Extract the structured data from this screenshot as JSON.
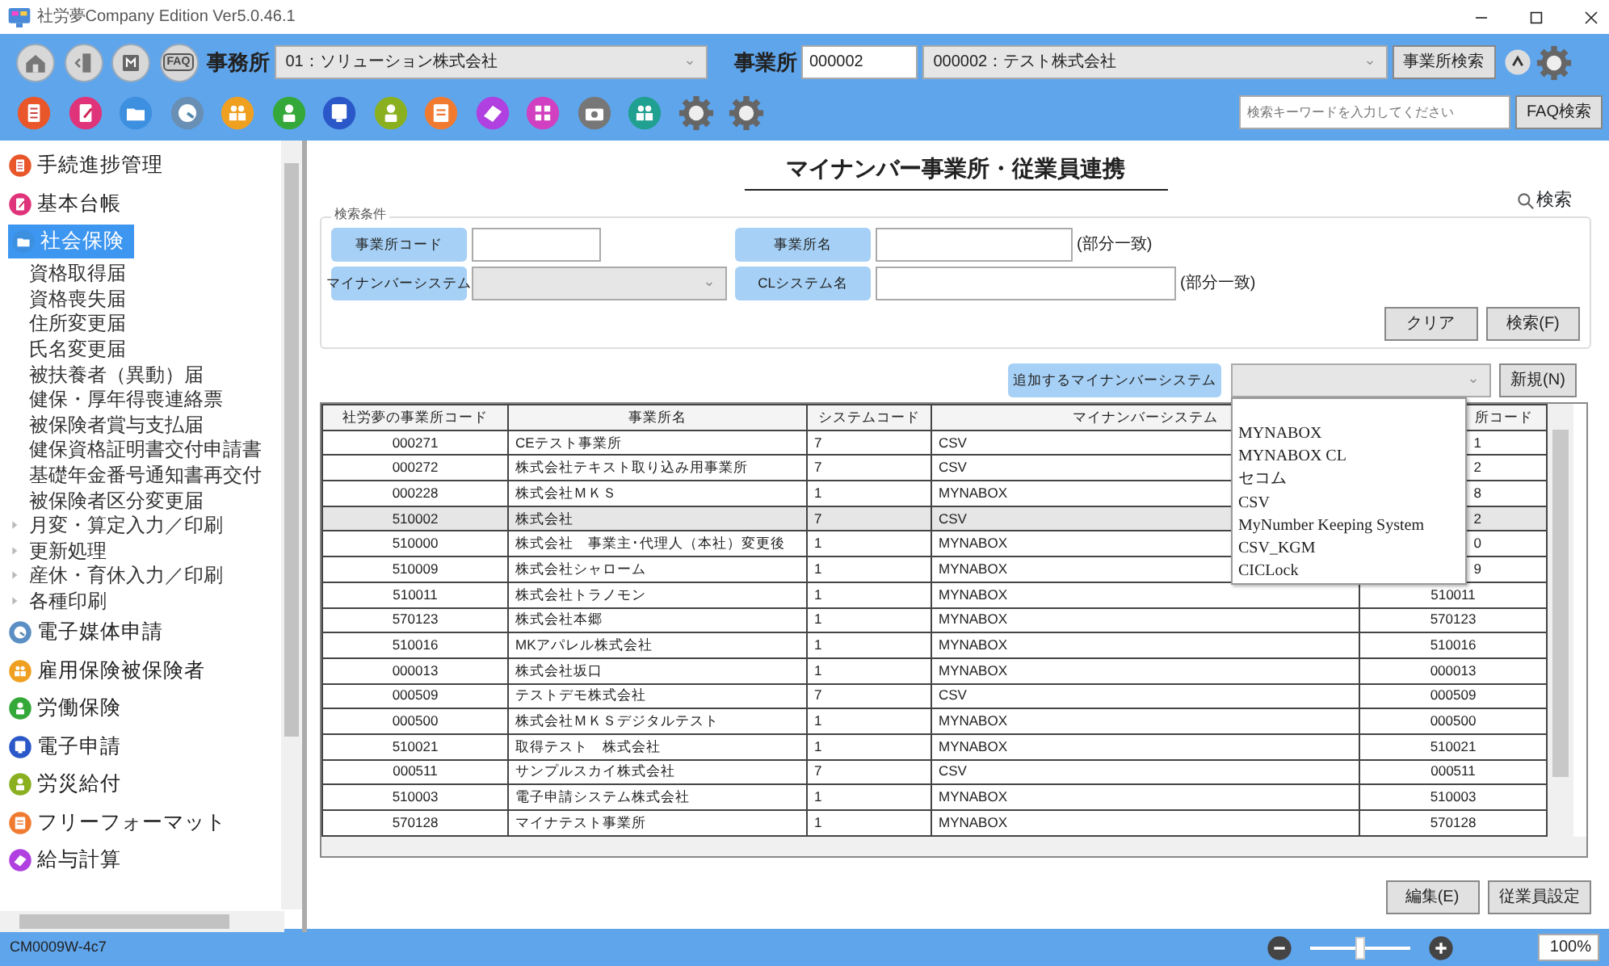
{
  "window": {
    "title": "社労夢Company Edition Ver5.0.46.1"
  },
  "toolbar": {
    "faq_button": "FAQ",
    "office_label": "事務所",
    "office_select": "01：ソリューション株式会社",
    "site_label": "事業所",
    "site_code": "000002",
    "site_select": "000002：テスト株式会社",
    "site_search_button": "事業所検索",
    "search": {
      "placeholder": "検索キーワードを入力してください"
    },
    "faq_search_button": "FAQ検索"
  },
  "sidebar": {
    "items": [
      {
        "label": "手続進捗管理",
        "color": "#e8562a",
        "selected": false
      },
      {
        "label": "基本台帳",
        "color": "#e0347a",
        "selected": false
      },
      {
        "label": "社会保険",
        "color": "#3d8fe0",
        "selected": true,
        "children": [
          {
            "label": "資格取得届",
            "kind": "leaf",
            "selected": false
          },
          {
            "label": "資格喪失届",
            "kind": "leaf",
            "selected": false
          },
          {
            "label": "住所変更届",
            "kind": "leaf",
            "selected": false
          },
          {
            "label": "氏名変更届",
            "kind": "leaf",
            "selected": false
          },
          {
            "label": "被扶養者（異動）届",
            "kind": "leaf",
            "selected": false
          },
          {
            "label": "健保・厚年得喪連絡票",
            "kind": "leaf",
            "selected": false
          },
          {
            "label": "被保険者賞与支払届",
            "kind": "leaf",
            "selected": false
          },
          {
            "label": "健保資格証明書交付申請書",
            "kind": "leaf",
            "selected": false
          },
          {
            "label": "基礎年金番号通知書再交付",
            "kind": "leaf",
            "selected": false
          },
          {
            "label": "被保険者区分変更届",
            "kind": "leaf",
            "selected": false
          },
          {
            "label": "月変・算定入力／印刷",
            "kind": "branch",
            "expanded": false,
            "selected": false
          },
          {
            "label": "更新処理",
            "kind": "branch",
            "expanded": false,
            "selected": false
          },
          {
            "label": "産休・育休入力／印刷",
            "kind": "branch",
            "expanded": false,
            "selected": false
          },
          {
            "label": "各種印刷",
            "kind": "branch",
            "expanded": false,
            "selected": false
          }
        ]
      },
      {
        "label": "電子媒体申請",
        "color": "#5b8fc4",
        "selected": false
      },
      {
        "label": "雇用保険被保険者",
        "color": "#f0a020",
        "selected": false
      },
      {
        "label": "労働保険",
        "color": "#35a83a",
        "selected": false
      },
      {
        "label": "電子申請",
        "color": "#2a58c8",
        "selected": false
      },
      {
        "label": "労災給付",
        "color": "#8ab020",
        "selected": false
      },
      {
        "label": "フリーフォーマット",
        "color": "#f07a30",
        "selected": false
      },
      {
        "label": "給与計算",
        "color": "#b040e0",
        "selected": false
      }
    ]
  },
  "main": {
    "title": "マイナンバー事業所・従業員連携",
    "search_link": "検索",
    "criteria": {
      "legend": "検索条件",
      "fields": [
        {
          "label": "事業所コード",
          "kind": "text"
        },
        {
          "label": "事業所名",
          "kind": "text",
          "hint": "(部分一致)"
        },
        {
          "label": "マイナンバーシステム",
          "kind": "select"
        },
        {
          "label": "CLシステム名",
          "kind": "text",
          "hint": "(部分一致)"
        }
      ],
      "buttons": [
        "クリア",
        "検索(F)"
      ]
    },
    "add_system": {
      "label": "追加するマイナンバーシステム",
      "expanded": true,
      "options": [
        "MYNABOX",
        "MYNABOX CL",
        "セコム",
        "CSV",
        "MyNumber Keeping System",
        "CSV_KGM",
        "CICLock"
      ],
      "new_button": "新規(N)"
    },
    "table": {
      "columns": [
        "社労夢の事業所コード",
        "事業所名",
        "システムコード",
        "マイナンバーシステム",
        "所コード"
      ],
      "rows": [
        {
          "cells": [
            "000271",
            "CEテスト事業所",
            "7",
            "CSV",
            "1"
          ],
          "selected": false,
          "covered": true
        },
        {
          "cells": [
            "000272",
            "株式会社テキスト取り込み用事業所",
            "7",
            "CSV",
            "2"
          ],
          "selected": false,
          "covered": true
        },
        {
          "cells": [
            "000228",
            "株式会社ＭＫＳ",
            "1",
            "MYNABOX",
            "8"
          ],
          "selected": false,
          "covered": true
        },
        {
          "cells": [
            "510002",
            "株式会社",
            "7",
            "CSV",
            "2"
          ],
          "selected": true,
          "covered": true
        },
        {
          "cells": [
            "510000",
            "株式会社　事業主･代理人（本社）変更後",
            "1",
            "MYNABOX",
            "0"
          ],
          "selected": false,
          "covered": true
        },
        {
          "cells": [
            "510009",
            "株式会社シャローム",
            "1",
            "MYNABOX",
            "9"
          ],
          "selected": false,
          "covered": true
        },
        {
          "cells": [
            "510011",
            "株式会社トラノモン",
            "1",
            "MYNABOX",
            "510011"
          ],
          "selected": false,
          "covered": false
        },
        {
          "cells": [
            "570123",
            "株式会社本郷",
            "1",
            "MYNABOX",
            "570123"
          ],
          "selected": false,
          "covered": false
        },
        {
          "cells": [
            "510016",
            "MKアパレル株式会社",
            "1",
            "MYNABOX",
            "510016"
          ],
          "selected": false,
          "covered": false
        },
        {
          "cells": [
            "000013",
            "株式会社坂口",
            "1",
            "MYNABOX",
            "000013"
          ],
          "selected": false,
          "covered": false
        },
        {
          "cells": [
            "000509",
            "テストデモ株式会社",
            "7",
            "CSV",
            "000509"
          ],
          "selected": false,
          "covered": false
        },
        {
          "cells": [
            "000500",
            "株式会社ＭＫＳデジタルテスト",
            "1",
            "MYNABOX",
            "000500"
          ],
          "selected": false,
          "covered": false
        },
        {
          "cells": [
            "510021",
            "取得テスト　株式会社",
            "1",
            "MYNABOX",
            "510021"
          ],
          "selected": false,
          "covered": false
        },
        {
          "cells": [
            "000511",
            "サンプルスカイ株式会社",
            "7",
            "CSV",
            "000511"
          ],
          "selected": false,
          "covered": false
        },
        {
          "cells": [
            "510003",
            "電子申請システム株式会社",
            "1",
            "MYNABOX",
            "510003"
          ],
          "selected": false,
          "covered": false
        },
        {
          "cells": [
            "570128",
            "マイナテスト事業所",
            "1",
            "MYNABOX",
            "570128"
          ],
          "selected": false,
          "covered": false
        }
      ]
    },
    "bottom_buttons": [
      "編集(E)",
      "従業員設定"
    ]
  },
  "status_bar": {
    "code": "CM0009W-4c7",
    "zoom": {
      "level": 0.5,
      "reading": "100%"
    }
  }
}
